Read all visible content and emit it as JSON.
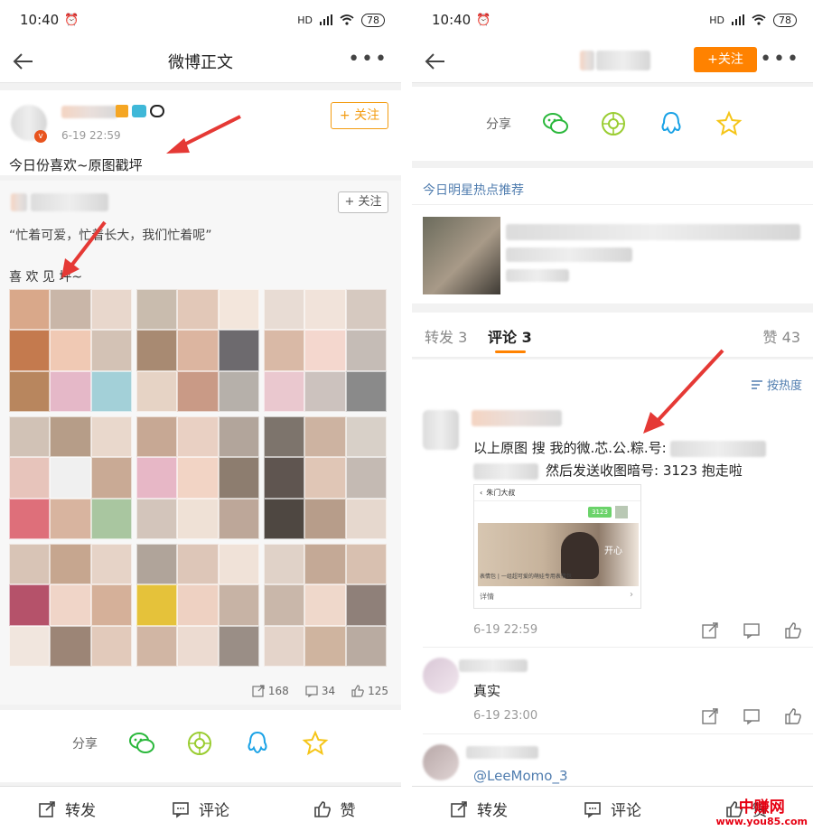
{
  "status_bar": {
    "time": "10:40",
    "network": "HD",
    "battery": "78"
  },
  "left": {
    "nav": {
      "title": "微博正文"
    },
    "post": {
      "timestamp": "6-19 22:59",
      "follow_label": "+ 关注",
      "text": "今日份喜欢~原图戳坪"
    },
    "repost": {
      "follow_label": "+ 关注",
      "quote": "“忙着可爱，忙着长大，我们忙着呢”",
      "caption": "喜 欢 见 坪~"
    },
    "stats": {
      "reposts": "168",
      "comments": "34",
      "likes": "125"
    },
    "share": {
      "label": "分享"
    },
    "actions": {
      "repost": "转发",
      "comment": "评论",
      "like": "赞"
    }
  },
  "right": {
    "nav": {
      "follow_label": "+关注"
    },
    "share": {
      "label": "分享"
    },
    "hot": {
      "heading": "今日明星热点推荐"
    },
    "tabs": {
      "repost": "转发 3",
      "comment": "评论 3",
      "like": "赞 43"
    },
    "sort": {
      "label": "按热度"
    },
    "comments": [
      {
        "text_line1": "以上原图 搜 我的微.芯.公.粽.号: ",
        "text_line2": "然后发送收图暗号: 3123  抱走啦",
        "image": {
          "header": "朱门大叔",
          "code": "3123",
          "overlay": "开心",
          "caption": "表情包 | 一组超可爱的萌娃专用表情包",
          "footer": "详情"
        },
        "time": "6-19 22:59"
      },
      {
        "text": "真实",
        "time": "6-19 23:00"
      },
      {
        "text": "@LeeMomo_3"
      }
    ],
    "actions": {
      "repost": "转发",
      "comment": "评论",
      "like": "赞"
    },
    "watermark": {
      "title": "中赚网",
      "url": "www.you85.com"
    }
  },
  "colors": {
    "accent": "#ff8200",
    "wechat": "#2bb83c",
    "moments": "#9acd32",
    "qq": "#1aa2e6",
    "favorite": "#f5c518",
    "link": "#507daf"
  }
}
